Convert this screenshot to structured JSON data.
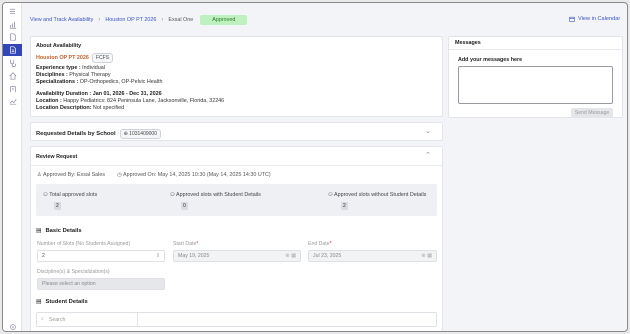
{
  "breadcrumb": {
    "items": [
      "View and Track Availability",
      "Houston OP PT 2026",
      "Exsal One"
    ],
    "status": "Approved"
  },
  "header": {
    "view_calendar": "View in Calendar"
  },
  "sidebar": {
    "items": [
      "menu-icon",
      "chart-icon",
      "document-icon",
      "document-active-icon",
      "stethoscope-icon",
      "home-icon",
      "building-icon",
      "image-icon",
      "analytics-icon",
      "settings-icon"
    ]
  },
  "about": {
    "title": "About Availability",
    "name": "Houston OP PT 2026",
    "tag": "FCFS",
    "experience_label": "Experience type :",
    "experience_value": "Individual",
    "disciplines_label": "Disciplines :",
    "disciplines_value": "Physical Therapy",
    "specializations_label": "Specializations :",
    "specializations_value": "OP-Orthopedics, OP-Pelvic Health",
    "duration_label": "Availability Duration :",
    "duration_value": "Jan 01, 2026 - Dec 31, 2026",
    "location_label": "Location :",
    "location_value": "Happy Pediatrics: 824 Peninsula Lane, Jacksonville, Florida, 32246",
    "location_desc_label": "Location Description:",
    "location_desc_value": "Not specified"
  },
  "requested": {
    "title": "Requested Details by School",
    "id": "1031409000"
  },
  "review": {
    "title": "Review Request",
    "approved_by": "Approved By: Exsal Sales",
    "approved_on": "Approved On: May 14, 2025 10:30 (May 14, 2025 14:30 UTC)",
    "stats": [
      {
        "label": "Total approved slots",
        "value": "2"
      },
      {
        "label": "Approved slots with Student Details",
        "value": "0"
      },
      {
        "label": "Approved slots without Student Details",
        "value": "2"
      }
    ],
    "basic_title": "Basic Details",
    "slots_label": "Number of Slots (No Students Assigned)",
    "slots_value": "2",
    "start_label": "Start Date",
    "start_value": "May 19, 2025",
    "end_label": "End Date",
    "end_value": "Jul 23, 2025",
    "disc_label": "Discipline(s) & Specialization(s)",
    "disc_placeholder": "Please select an option",
    "student_title": "Student Details",
    "search_placeholder": "Search"
  },
  "messages": {
    "title": "Messages",
    "add_label": "Add your messages here",
    "send": "Send Message"
  },
  "colors": {
    "accent": "#3346b8",
    "link": "#3c52c4",
    "approved_bg": "#bff0bf",
    "orange": "#c0612b"
  }
}
